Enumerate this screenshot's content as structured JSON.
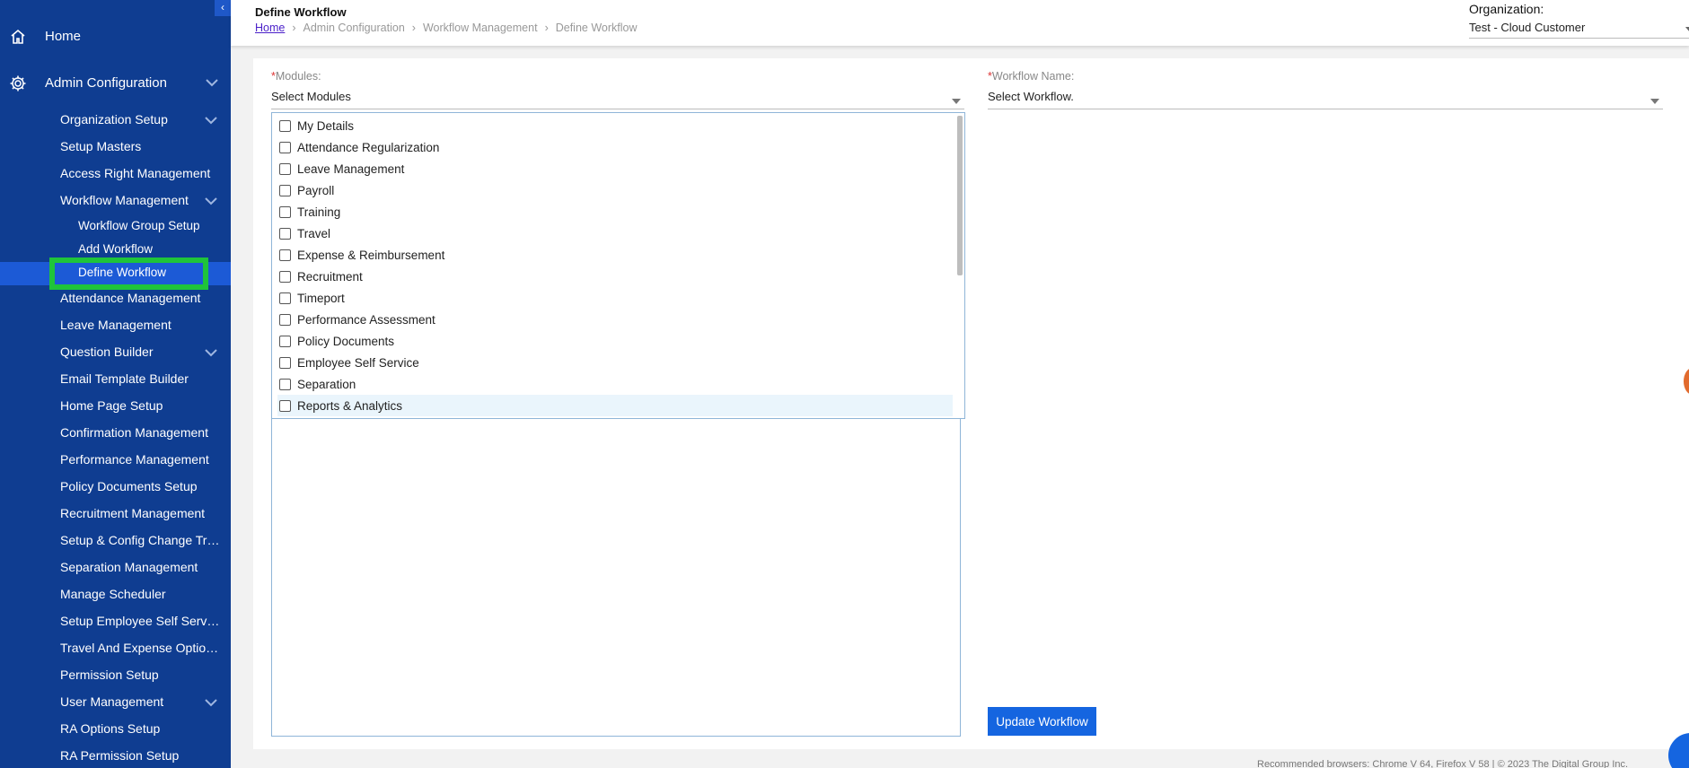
{
  "sidebar": {
    "collapse_glyph": "‹",
    "home_label": "Home",
    "admin_label": "Admin Configuration",
    "items": [
      {
        "label": "Organization Setup",
        "has_chevron": true
      },
      {
        "label": "Setup Masters"
      },
      {
        "label": "Access Right Management"
      },
      {
        "label": "Workflow Management",
        "has_chevron": true
      },
      {
        "label": "Attendance Management"
      },
      {
        "label": "Leave Management"
      },
      {
        "label": "Question Builder",
        "has_chevron": true
      },
      {
        "label": "Email Template Builder"
      },
      {
        "label": "Home Page Setup"
      },
      {
        "label": "Confirmation Management"
      },
      {
        "label": "Performance Management"
      },
      {
        "label": "Policy Documents Setup"
      },
      {
        "label": "Recruitment Management"
      },
      {
        "label": "Setup & Config Change Trac..."
      },
      {
        "label": "Separation Management"
      },
      {
        "label": "Manage Scheduler"
      },
      {
        "label": "Setup Employee Self Service"
      },
      {
        "label": "Travel And Expense Option..."
      },
      {
        "label": "Permission Setup"
      },
      {
        "label": "User Management",
        "has_chevron": true
      },
      {
        "label": "RA Options Setup"
      },
      {
        "label": "RA Permission Setup"
      }
    ],
    "workflow_sub": [
      {
        "label": "Workflow Group Setup"
      },
      {
        "label": "Add Workflow"
      },
      {
        "label": "Define Workflow",
        "active": true
      }
    ]
  },
  "header": {
    "title": "Define Workflow",
    "breadcrumb": [
      "Home",
      "Admin Configuration",
      "Workflow Management",
      "Define Workflow"
    ],
    "org_label": "Organization:",
    "org_value": "Test - Cloud Customer"
  },
  "form": {
    "modules_label": "Modules:",
    "modules_value": "Select Modules",
    "workflow_label": "Workflow Name:",
    "workflow_value": "Select Workflow.",
    "required_mark": "*",
    "module_options": [
      "My Details",
      "Attendance Regularization",
      "Leave Management",
      "Payroll",
      "Training",
      "Travel",
      "Expense & Reimbursement",
      "Recruitment",
      "Timeport",
      "Performance Assessment",
      "Policy Documents",
      "Employee Self Service",
      "Separation",
      "Reports & Analytics"
    ],
    "highlighted_option": "Reports & Analytics",
    "update_button": "Update Workflow"
  },
  "footer": {
    "text": "Recommended browsers: Chrome V 64, Firefox V 58  |  © 2023 The Digital Group Inc."
  },
  "colors": {
    "sidebar_bg": "#0f3d91",
    "active_row": "#1c5ad6",
    "highlight_box": "#1fc43a",
    "primary_button": "#1565e0"
  }
}
